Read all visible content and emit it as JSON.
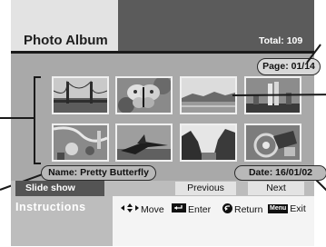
{
  "header": {
    "title": "Photo Album",
    "total": "Total: 109"
  },
  "page": "Page: 01/14",
  "thumbnails": [
    {
      "name": "bridge-thumbnail"
    },
    {
      "name": "butterfly-thumbnail"
    },
    {
      "name": "lake-thumbnail"
    },
    {
      "name": "skyline-thumbnail"
    },
    {
      "name": "waterpark-thumbnail"
    },
    {
      "name": "fighter-jet-thumbnail"
    },
    {
      "name": "canyon-thumbnail"
    },
    {
      "name": "motorcycle-thumbnail"
    }
  ],
  "selected_name": "Name: Pretty Butterfly",
  "selected_date": "Date: 16/01/02",
  "buttons": {
    "slideshow": "Slide show",
    "previous": "Previous",
    "next": "Next"
  },
  "instructions": {
    "label": "Instructions",
    "move": "Move",
    "enter": "Enter",
    "return": "Return",
    "menu_key": "Menu",
    "exit": "Exit"
  }
}
